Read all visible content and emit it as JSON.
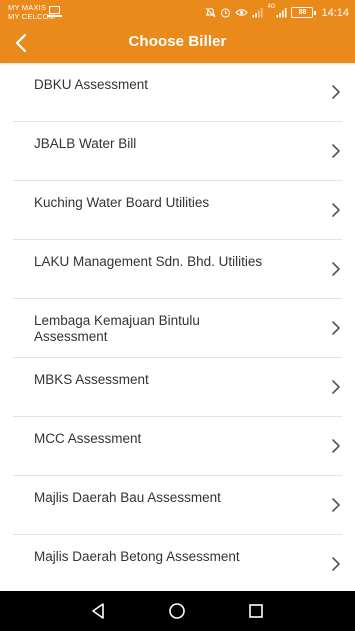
{
  "status_bar": {
    "carrier_1": "MY MAXIS",
    "carrier_2": "MY CELCOM",
    "network_type": "4G",
    "battery": "88",
    "time": "14:14",
    "icons": [
      "screen-cast-icon",
      "mute-icon",
      "alarm-icon",
      "eye-comfort-icon",
      "signal-icon",
      "signal-icon",
      "battery-icon"
    ]
  },
  "header": {
    "title": "Choose Biller",
    "back_icon": "chevron-left-icon"
  },
  "billers": [
    {
      "label": "DBKU Assessment"
    },
    {
      "label": "JBALB Water Bill"
    },
    {
      "label": "Kuching Water Board Utilities"
    },
    {
      "label": "LAKU Management Sdn. Bhd. Utilities"
    },
    {
      "label": "Lembaga Kemajuan Bintulu Assessment"
    },
    {
      "label": "MBKS Assessment"
    },
    {
      "label": "MCC Assessment"
    },
    {
      "label": "Majlis Daerah Bau Assessment"
    },
    {
      "label": "Majlis Daerah Betong Assessment"
    }
  ],
  "nav_bar": {
    "icons": [
      "back-triangle-icon",
      "home-circle-icon",
      "recents-square-icon"
    ]
  },
  "colors": {
    "brand": "#ea8a1a",
    "text": "#333333",
    "divider": "#e2e2e2"
  }
}
